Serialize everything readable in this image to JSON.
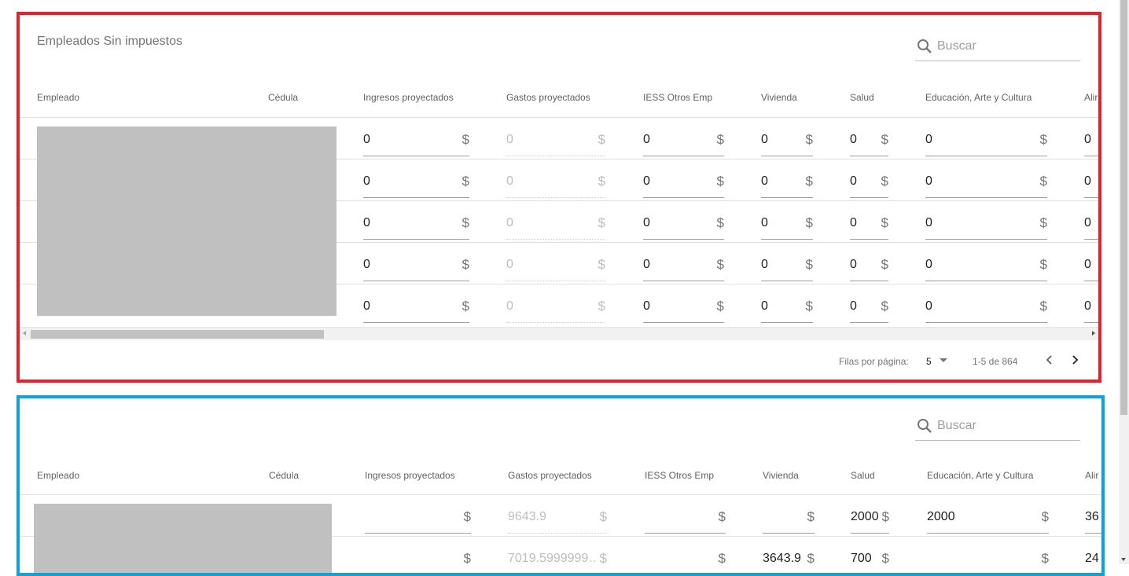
{
  "panel1": {
    "title": "Empleados Sin impuestos",
    "search_placeholder": "Buscar",
    "columns": [
      "Empleado",
      "Cédula",
      "Ingresos proyectados",
      "Gastos proyectados",
      "IESS Otros Emp",
      "Vivienda",
      "Salud",
      "Educación, Arte y Cultura",
      "Alir"
    ],
    "rows": [
      [
        "0",
        "0",
        "0",
        "0",
        "0",
        "0",
        "0"
      ],
      [
        "0",
        "0",
        "0",
        "0",
        "0",
        "0",
        "0"
      ],
      [
        "0",
        "0",
        "0",
        "0",
        "0",
        "0",
        "0"
      ],
      [
        "0",
        "0",
        "0",
        "0",
        "0",
        "0",
        "0"
      ],
      [
        "0",
        "0",
        "0",
        "0",
        "0",
        "0",
        "0"
      ]
    ],
    "pager": {
      "rows_per_page_label": "Filas por página:",
      "rows_per_page_value": "5",
      "range": "1-5 de 864"
    }
  },
  "panel2": {
    "search_placeholder": "Buscar",
    "columns": [
      "Empleado",
      "Cédula",
      "Ingresos proyectados",
      "Gastos proyectados",
      "IESS Otros Emp",
      "Vivienda",
      "Salud",
      "Educación, Arte y Cultura",
      "Alir"
    ],
    "rows": [
      [
        "",
        "9643.9",
        "",
        "",
        "2000",
        "2000",
        "36"
      ],
      [
        "",
        "7019.5999999…",
        "",
        "3643.9",
        "700",
        "",
        "24"
      ]
    ]
  },
  "currency_symbol": "$",
  "colors": {
    "panel1_border": "#e8202b",
    "panel2_border": "#0aa3e0"
  },
  "icons": {
    "search": "search-icon",
    "dropdown": "caret-down-icon",
    "prev": "chevron-left-icon",
    "next": "chevron-right-icon"
  }
}
